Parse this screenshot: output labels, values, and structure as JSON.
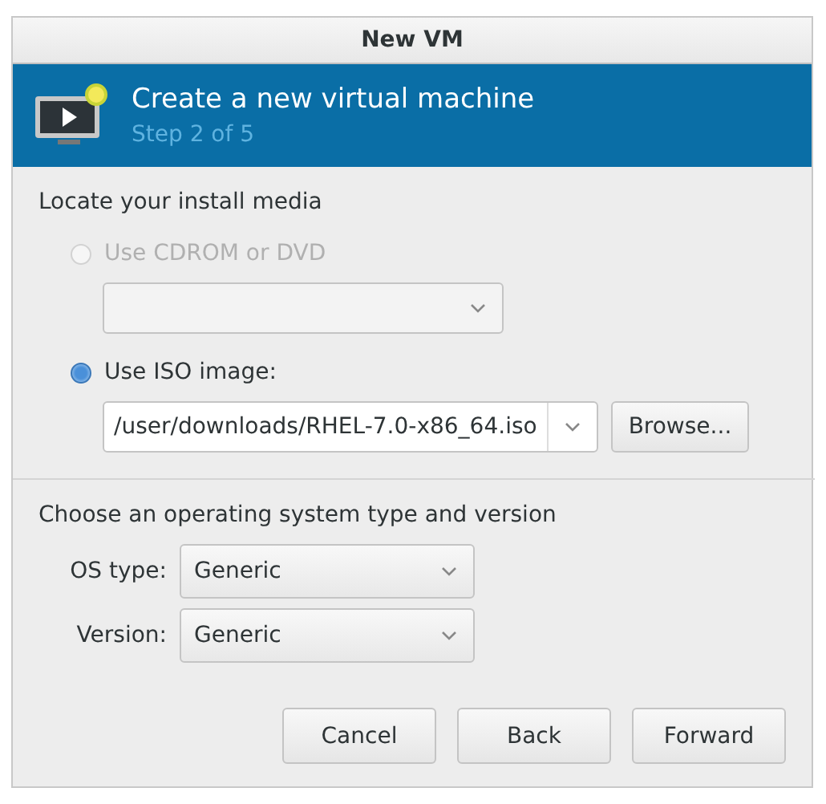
{
  "window": {
    "title": "New VM"
  },
  "header": {
    "title": "Create a new virtual machine",
    "step": "Step 2 of 5"
  },
  "media": {
    "heading": "Locate your install media",
    "options": [
      {
        "label": "Use CDROM or DVD",
        "selected": false,
        "disabled": true
      },
      {
        "label": "Use ISO image:",
        "selected": true,
        "disabled": false,
        "path": "/user/downloads/RHEL-7.0-x86_64.iso",
        "browse": "Browse..."
      }
    ]
  },
  "os": {
    "heading": "Choose an operating system type and version",
    "fields": [
      {
        "label": "OS type:",
        "value": "Generic"
      },
      {
        "label": "Version:",
        "value": "Generic"
      }
    ]
  },
  "buttons": [
    "Cancel",
    "Back",
    "Forward"
  ]
}
